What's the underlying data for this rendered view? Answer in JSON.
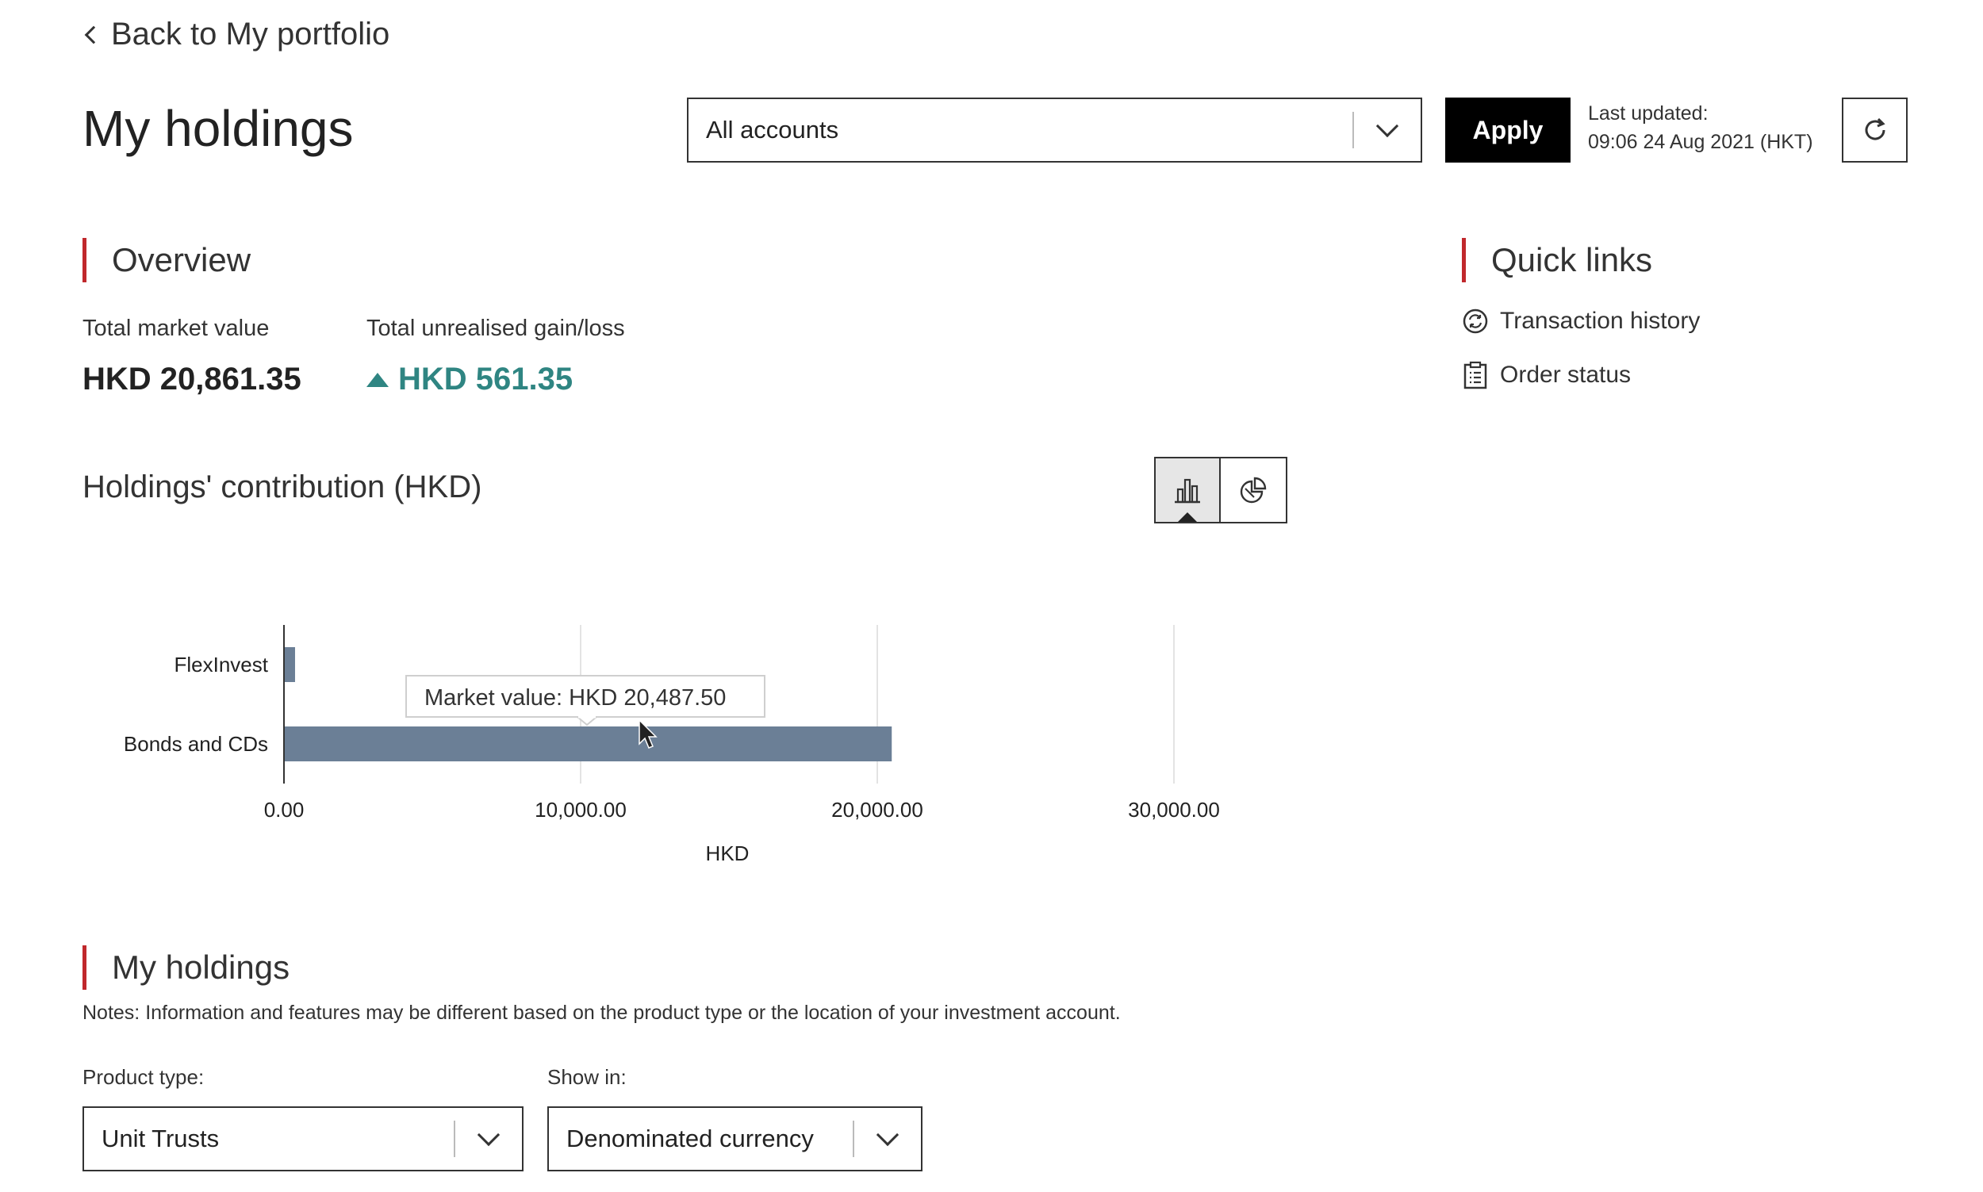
{
  "nav": {
    "back_label": "Back to My portfolio"
  },
  "page_title": "My holdings",
  "account_select": {
    "value": "All accounts"
  },
  "apply_label": "Apply",
  "last_updated": {
    "label": "Last updated:",
    "value": "09:06 24 Aug 2021 (HKT)"
  },
  "overview": {
    "title": "Overview",
    "total_market_value_label": "Total market value",
    "total_market_value": "HKD 20,861.35",
    "total_unrealised_label": "Total unrealised gain/loss",
    "total_unrealised": "HKD 561.35",
    "gain_color": "#2f8582"
  },
  "quick_links": {
    "title": "Quick links",
    "items": [
      {
        "label": "Transaction history",
        "icon": "transaction-history-icon"
      },
      {
        "label": "Order status",
        "icon": "clipboard-icon"
      }
    ]
  },
  "chart": {
    "title": "Holdings' contribution (HKD)",
    "toggle": {
      "active": "bar-chart-icon",
      "options": [
        "bar-chart-icon",
        "pie-chart-icon"
      ]
    },
    "tooltip": "Market value: HKD 20,487.50"
  },
  "chart_data": {
    "type": "bar",
    "orientation": "horizontal",
    "categories": [
      "FlexInvest",
      "Bonds and CDs"
    ],
    "values": [
      373.85,
      20487.5
    ],
    "xlabel": "HKD",
    "ylabel": "",
    "xlim": [
      0,
      30000
    ],
    "ticks": [
      "0.00",
      "10,000.00",
      "20,000.00",
      "30,000.00"
    ],
    "tick_values": [
      0,
      10000,
      20000,
      30000
    ],
    "grid": true,
    "bar_color": "#6b7f96"
  },
  "holdings": {
    "title": "My holdings",
    "notes": "Notes: Information and features may be different based on the product type or the location of your investment account.",
    "product_type_label": "Product type:",
    "product_type_value": "Unit Trusts",
    "show_in_label": "Show in:",
    "show_in_value": "Denominated currency"
  },
  "accent_color": "#c0282c"
}
